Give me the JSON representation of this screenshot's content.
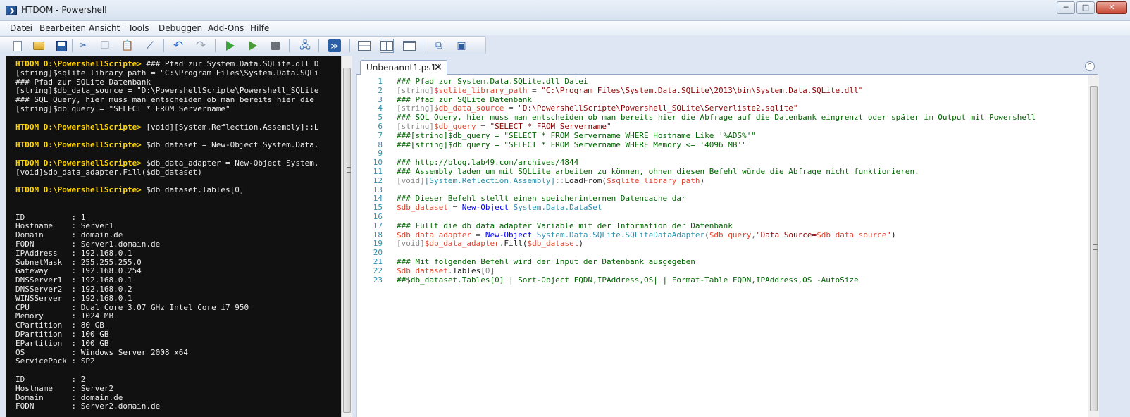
{
  "window": {
    "title": "HTDOM - Powershell",
    "controls": {
      "minimize": "─",
      "maximize": "□",
      "close": "✕"
    }
  },
  "menu": [
    {
      "label": "Datei"
    },
    {
      "label": "Bearbeiten"
    },
    {
      "label": "Ansicht"
    },
    {
      "label": "Tools"
    },
    {
      "label": "Debuggen"
    },
    {
      "label": "Add-Ons"
    },
    {
      "label": "Hilfe"
    }
  ],
  "toolbar": [
    {
      "icon": "new-file-icon"
    },
    {
      "icon": "open-folder-icon"
    },
    {
      "icon": "save-icon"
    },
    {
      "icon": "cut-icon"
    },
    {
      "icon": "copy-icon"
    },
    {
      "icon": "paste-icon"
    },
    {
      "icon": "clear-icon"
    },
    {
      "icon": "undo-icon"
    },
    {
      "icon": "redo-icon"
    },
    {
      "icon": "run-script-icon"
    },
    {
      "icon": "run-selection-icon"
    },
    {
      "icon": "stop-icon"
    },
    {
      "icon": "remote-powershell-icon"
    },
    {
      "icon": "start-powershell-icon"
    },
    {
      "icon": "layout-top-icon"
    },
    {
      "icon": "layout-right-icon"
    },
    {
      "icon": "layout-max-icon"
    },
    {
      "icon": "show-commands-icon"
    },
    {
      "icon": "show-addon-icon"
    }
  ],
  "console": {
    "lines": [
      {
        "kind": "prompt",
        "prompt": "HTDOM D:\\PowershellScripte>",
        "text": " ### Pfad zur System.Data.SQLite.dll D"
      },
      {
        "kind": "text",
        "text": "[string]$sqlite_library_path = \"C:\\Program Files\\System.Data.SQLi"
      },
      {
        "kind": "text",
        "text": "### Pfad zur SQLite Datenbank"
      },
      {
        "kind": "text",
        "text": "[string]$db_data_source = \"D:\\PowershellScripte\\Powershell_SQLite"
      },
      {
        "kind": "text",
        "text": "### SQL Query, hier muss man entscheiden ob man bereits hier die"
      },
      {
        "kind": "text",
        "text": "[string]$db_query = \"SELECT * FROM Servername\""
      },
      {
        "kind": "blank",
        "text": ""
      },
      {
        "kind": "prompt",
        "prompt": "HTDOM D:\\PowershellScripte>",
        "text": " [void][System.Reflection.Assembly]::L"
      },
      {
        "kind": "blank",
        "text": ""
      },
      {
        "kind": "prompt",
        "prompt": "HTDOM D:\\PowershellScripte>",
        "text": " $db_dataset = New-Object System.Data."
      },
      {
        "kind": "blank",
        "text": ""
      },
      {
        "kind": "prompt",
        "prompt": "HTDOM D:\\PowershellScripte>",
        "text": " $db_data_adapter = New-Object System."
      },
      {
        "kind": "text",
        "text": "[void]$db_data_adapter.Fill($db_dataset)"
      },
      {
        "kind": "blank",
        "text": ""
      },
      {
        "kind": "prompt",
        "prompt": "HTDOM D:\\PowershellScripte>",
        "text": " $db_dataset.Tables[0]"
      },
      {
        "kind": "blank",
        "text": ""
      },
      {
        "kind": "blank",
        "text": ""
      },
      {
        "kind": "text",
        "text": "ID          : 1"
      },
      {
        "kind": "text",
        "text": "Hostname    : Server1"
      },
      {
        "kind": "text",
        "text": "Domain      : domain.de"
      },
      {
        "kind": "text",
        "text": "FQDN        : Server1.domain.de"
      },
      {
        "kind": "text",
        "text": "IPAddress   : 192.168.0.1"
      },
      {
        "kind": "text",
        "text": "SubnetMask  : 255.255.255.0"
      },
      {
        "kind": "text",
        "text": "Gateway     : 192.168.0.254"
      },
      {
        "kind": "text",
        "text": "DNSServer1  : 192.168.0.1"
      },
      {
        "kind": "text",
        "text": "DNSServer2  : 192.168.0.2"
      },
      {
        "kind": "text",
        "text": "WINSServer  : 192.168.0.1"
      },
      {
        "kind": "text",
        "text": "CPU         : Dual Core 3.07 GHz Intel Core i7 950"
      },
      {
        "kind": "text",
        "text": "Memory      : 1024 MB"
      },
      {
        "kind": "text",
        "text": "CPartition  : 80 GB"
      },
      {
        "kind": "text",
        "text": "DPartition  : 100 GB"
      },
      {
        "kind": "text",
        "text": "EPartition  : 100 GB"
      },
      {
        "kind": "text",
        "text": "OS          : Windows Server 2008 x64"
      },
      {
        "kind": "text",
        "text": "ServicePack : SP2"
      },
      {
        "kind": "blank",
        "text": ""
      },
      {
        "kind": "text",
        "text": "ID          : 2"
      },
      {
        "kind": "text",
        "text": "Hostname    : Server2"
      },
      {
        "kind": "text",
        "text": "Domain      : domain.de"
      },
      {
        "kind": "text",
        "text": "FQDN        : Server2.domain.de"
      }
    ]
  },
  "editor": {
    "tab_label": "Unbenannt1.ps1*",
    "tab_close": "✕",
    "collapse_glyph": "⌃",
    "lines": [
      {
        "n": "1",
        "tokens": [
          [
            "c",
            "### Pfad zur System.Data.SQLite.dll Datei"
          ]
        ]
      },
      {
        "n": "2",
        "tokens": [
          [
            "t",
            "[string]"
          ],
          [
            "v",
            "$sqlite_library_path"
          ],
          [
            "p",
            " = "
          ],
          [
            "s",
            "\"C:\\Program Files\\System.Data.SQLite\\2013\\bin\\System.Data.SQLite.dll\""
          ]
        ]
      },
      {
        "n": "3",
        "tokens": [
          [
            "c",
            "### Pfad zur SQLite Datenbank"
          ]
        ]
      },
      {
        "n": "4",
        "tokens": [
          [
            "t",
            "[string]"
          ],
          [
            "v",
            "$db_data_source"
          ],
          [
            "p",
            " = "
          ],
          [
            "s",
            "\"D:\\PowershellScripte\\Powershell_SQLite\\Serverliste2.sqlite\""
          ]
        ]
      },
      {
        "n": "5",
        "tokens": [
          [
            "c",
            "### SQL Query, hier muss man entscheiden ob man bereits hier die Abfrage auf die Datenbank eingrenzt oder später im Output mit Powershell"
          ]
        ]
      },
      {
        "n": "6",
        "tokens": [
          [
            "t",
            "[string]"
          ],
          [
            "v",
            "$db_query"
          ],
          [
            "p",
            " = "
          ],
          [
            "s",
            "\"SELECT * FROM Servername\""
          ]
        ]
      },
      {
        "n": "7",
        "tokens": [
          [
            "c",
            "###[string]$db_query = \"SELECT * FROM Servername WHERE Hostname Like '%ADS%'\""
          ]
        ]
      },
      {
        "n": "8",
        "tokens": [
          [
            "c",
            "###[string]$db_query = \"SELECT * FROM Servername WHERE Memory <= '4096 MB'\""
          ]
        ]
      },
      {
        "n": "9",
        "tokens": []
      },
      {
        "n": "10",
        "tokens": [
          [
            "c",
            "### http://blog.lab49.com/archives/4844"
          ]
        ]
      },
      {
        "n": "11",
        "tokens": [
          [
            "c",
            "### Assembly laden um mit SQLLite arbeiten zu können, ohnen diesen Befehl würde die Abfrage nicht funktionieren."
          ]
        ]
      },
      {
        "n": "12",
        "tokens": [
          [
            "t",
            "[void]"
          ],
          [
            "k",
            "[System.Reflection.Assembly]"
          ],
          [
            "t",
            "::"
          ],
          [
            "m",
            "LoadFrom("
          ],
          [
            "v",
            "$sqlite_library_path"
          ],
          [
            "m",
            ")"
          ]
        ]
      },
      {
        "n": "13",
        "tokens": []
      },
      {
        "n": "14",
        "tokens": [
          [
            "c",
            "### Dieser Befehl stellt einen speicherinternen Datencache dar"
          ]
        ]
      },
      {
        "n": "15",
        "tokens": [
          [
            "v",
            "$db_dataset"
          ],
          [
            "p",
            " = "
          ],
          [
            "x",
            "New-Object"
          ],
          [
            "p",
            " "
          ],
          [
            "k",
            "System.Data.DataSet"
          ]
        ]
      },
      {
        "n": "16",
        "tokens": []
      },
      {
        "n": "17",
        "tokens": [
          [
            "c",
            "### Füllt die db_data_adapter Variable mit der Information der Datenbank"
          ]
        ]
      },
      {
        "n": "18",
        "tokens": [
          [
            "v",
            "$db_data_adapter"
          ],
          [
            "p",
            " = "
          ],
          [
            "x",
            "New-Object"
          ],
          [
            "p",
            " "
          ],
          [
            "k",
            "System.Data.SQLite.SQLiteDataAdapter"
          ],
          [
            "m",
            "("
          ],
          [
            "v",
            "$db_query"
          ],
          [
            "p",
            ","
          ],
          [
            "s",
            "\"Data Source="
          ],
          [
            "v",
            "$db_data_source"
          ],
          [
            "s",
            "\""
          ],
          [
            "m",
            ")"
          ]
        ]
      },
      {
        "n": "19",
        "tokens": [
          [
            "t",
            "[void]"
          ],
          [
            "v",
            "$db_data_adapter"
          ],
          [
            "p",
            "."
          ],
          [
            "m",
            "Fill("
          ],
          [
            "v",
            "$db_dataset"
          ],
          [
            "m",
            ")"
          ]
        ]
      },
      {
        "n": "20",
        "tokens": []
      },
      {
        "n": "21",
        "tokens": [
          [
            "c",
            "### Mit folgenden Befehl wird der Input der Datenbank ausgegeben"
          ]
        ]
      },
      {
        "n": "22",
        "tokens": [
          [
            "v",
            "$db_dataset"
          ],
          [
            "p",
            "."
          ],
          [
            "m",
            "Tables["
          ],
          [
            "t",
            "0"
          ],
          [
            "m",
            "]"
          ]
        ]
      },
      {
        "n": "23",
        "tokens": [
          [
            "c",
            "##$db_dataset.Tables[0] | Sort-Object FQDN,IPAddress,OS| | Format-Table FQDN,IPAddress,OS -AutoSize"
          ]
        ]
      }
    ]
  },
  "colors": {
    "console_bg": "#111111",
    "console_prompt": "#ffd400",
    "editor_bg": "#ffffff",
    "line_numbers": "#2b91af"
  }
}
